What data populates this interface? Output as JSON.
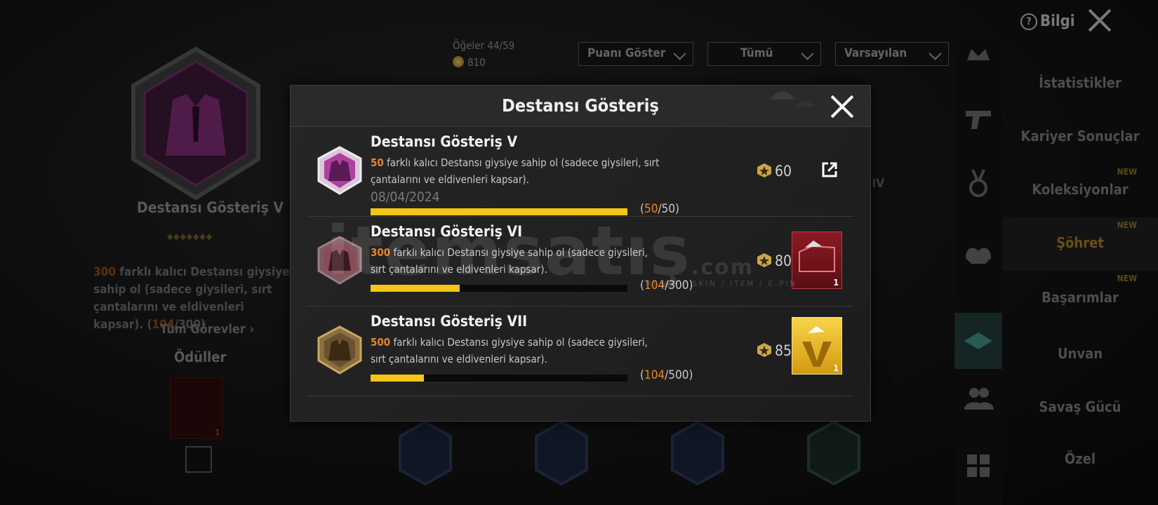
{
  "top_right": {
    "help_label": "Bilgi"
  },
  "stats": {
    "label": "Öğeler 44/59",
    "points": "810"
  },
  "filters": {
    "sort_mode": "Puanı Göster",
    "category": "Tümü",
    "order": "Varsayılan"
  },
  "left_panel": {
    "title": "Destansı Gösteriş V",
    "dots": "◆◆◆◆◆◆◆",
    "desc_num": "300",
    "desc_text": " farklı kalıcı Destansı giysiye sahip ol (sadece giysileri, sırt çantalarını ve eldivenleri kapsar). (",
    "desc_progress": "104",
    "desc_total": "/300)",
    "all_tasks": "Tüm Görevler",
    "rewards_label": "Ödüller",
    "reward_count": "1"
  },
  "sidebar": {
    "items": [
      {
        "label": "İstatistikler",
        "new": ""
      },
      {
        "label": "Kariyer Sonuçlar",
        "new": ""
      },
      {
        "label": "Koleksiyonlar",
        "new": "NEW"
      },
      {
        "label": "Şöhret",
        "new": "NEW"
      },
      {
        "label": "Başarımlar",
        "new": "NEW"
      },
      {
        "label": "Unvan",
        "new": ""
      },
      {
        "label": "Savaş Gücü",
        "new": ""
      },
      {
        "label": "Özel",
        "new": ""
      }
    ],
    "icons": [
      "crown-icon",
      "pistol-icon",
      "medal-icon",
      "muscle-icon",
      "wings-icon",
      "friends-icon",
      "grid-icon"
    ]
  },
  "bg_tier_label": "i IV",
  "modal": {
    "title": "Destansı Gösteriş",
    "rows": [
      {
        "title": "Destansı Gösteriş V",
        "num": "50",
        "desc": " farklı kalıcı Destansı giysiye sahip ol (sadece giysileri, sırt çantalarını ve eldivenleri kapsar).",
        "date": "08/04/2024",
        "progress": "50",
        "total": "/50)",
        "progress_fraction": 1.0,
        "points": "60",
        "reward": "share"
      },
      {
        "title": "Destansı Gösteriş VI",
        "num": "300",
        "desc": " farklı kalıcı Destansı giysiye sahip ol (sadece giysileri, sırt çantalarını ve eldivenleri kapsar).",
        "date": "",
        "progress": "104",
        "total": "/300)",
        "progress_fraction": 0.347,
        "points": "80",
        "reward": "red-crate",
        "reward_count": "1"
      },
      {
        "title": "Destansı Gösteriş VII",
        "num": "500",
        "desc": " farklı kalıcı Destansı giysiye sahip ol (sadece giysileri, sırt çantalarını ve eldivenleri kapsar).",
        "date": "",
        "progress": "104",
        "total": "/500)",
        "progress_fraction": 0.208,
        "points": "85",
        "reward": "gold-crate",
        "reward_count": "1"
      }
    ]
  },
  "watermark": {
    "main": "itemsatış",
    "sub": "HESAP / SKIN / ITEM / E-PIN",
    "com": ".com"
  },
  "colors": {
    "accent": "#f5c518",
    "highlight": "#e8842a",
    "panel": "#222222"
  }
}
